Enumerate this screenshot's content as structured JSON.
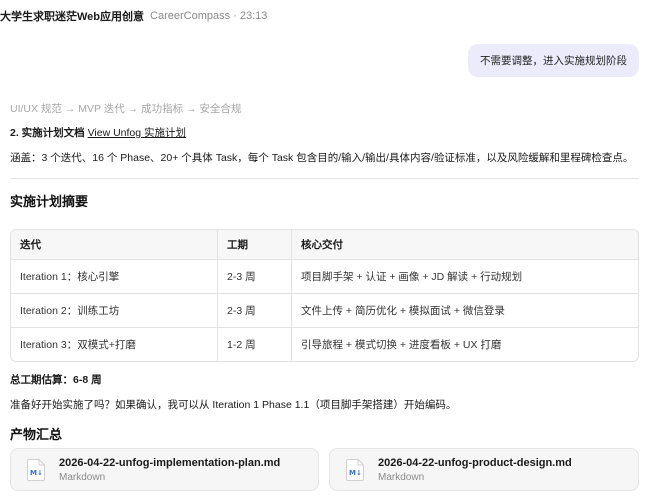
{
  "header": {
    "title": "大学生求职迷茫Web应用创意",
    "meta": "CareerCompass · 23:13"
  },
  "user_message": "不需要调整，进入实施规划阶段",
  "faded_line": "UI/UX 规范 → MVP 迭代 → 成功指标 → 安全合规",
  "plan_doc": {
    "prefix": "2. 实施计划文档",
    "link": "View Unfog 实施计划"
  },
  "summary_line": "涵盖：3 个迭代、16 个 Phase、20+ 个具体 Task，每个 Task 包含目的/输入/输出/具体内容/验证标准，以及风险缓解和里程碑检查点。",
  "plan_heading": "实施计划摘要",
  "table": {
    "headers": [
      "迭代",
      "工期",
      "核心交付"
    ],
    "rows": [
      [
        "Iteration 1：核心引擎",
        "2-3 周",
        "项目脚手架 + 认证 + 画像 + JD 解读 + 行动规划"
      ],
      [
        "Iteration 2：训练工坊",
        "2-3 周",
        "文件上传 + 简历优化 + 模拟面试 + 微信登录"
      ],
      [
        "Iteration 3：双模式+打磨",
        "1-2 周",
        "引导旅程 + 模式切换 + 进度看板 + UX 打磨"
      ]
    ]
  },
  "total": "总工期估算：6-8 周",
  "confirm": "准备好开始实施了吗？如果确认，我可以从 Iteration 1 Phase 1.1（项目脚手架搭建）开始编码。",
  "products_heading": "产物汇总",
  "files": [
    {
      "name": "2026-04-22-unfog-implementation-plan.md",
      "type": "Markdown",
      "icon": "markdown-file-icon"
    },
    {
      "name": "2026-04-22-unfog-product-design.md",
      "type": "Markdown",
      "icon": "markdown-file-icon"
    }
  ],
  "colors": {
    "user_bubble": "#ecebfb",
    "markdown_icon": "#3b6fd4"
  }
}
